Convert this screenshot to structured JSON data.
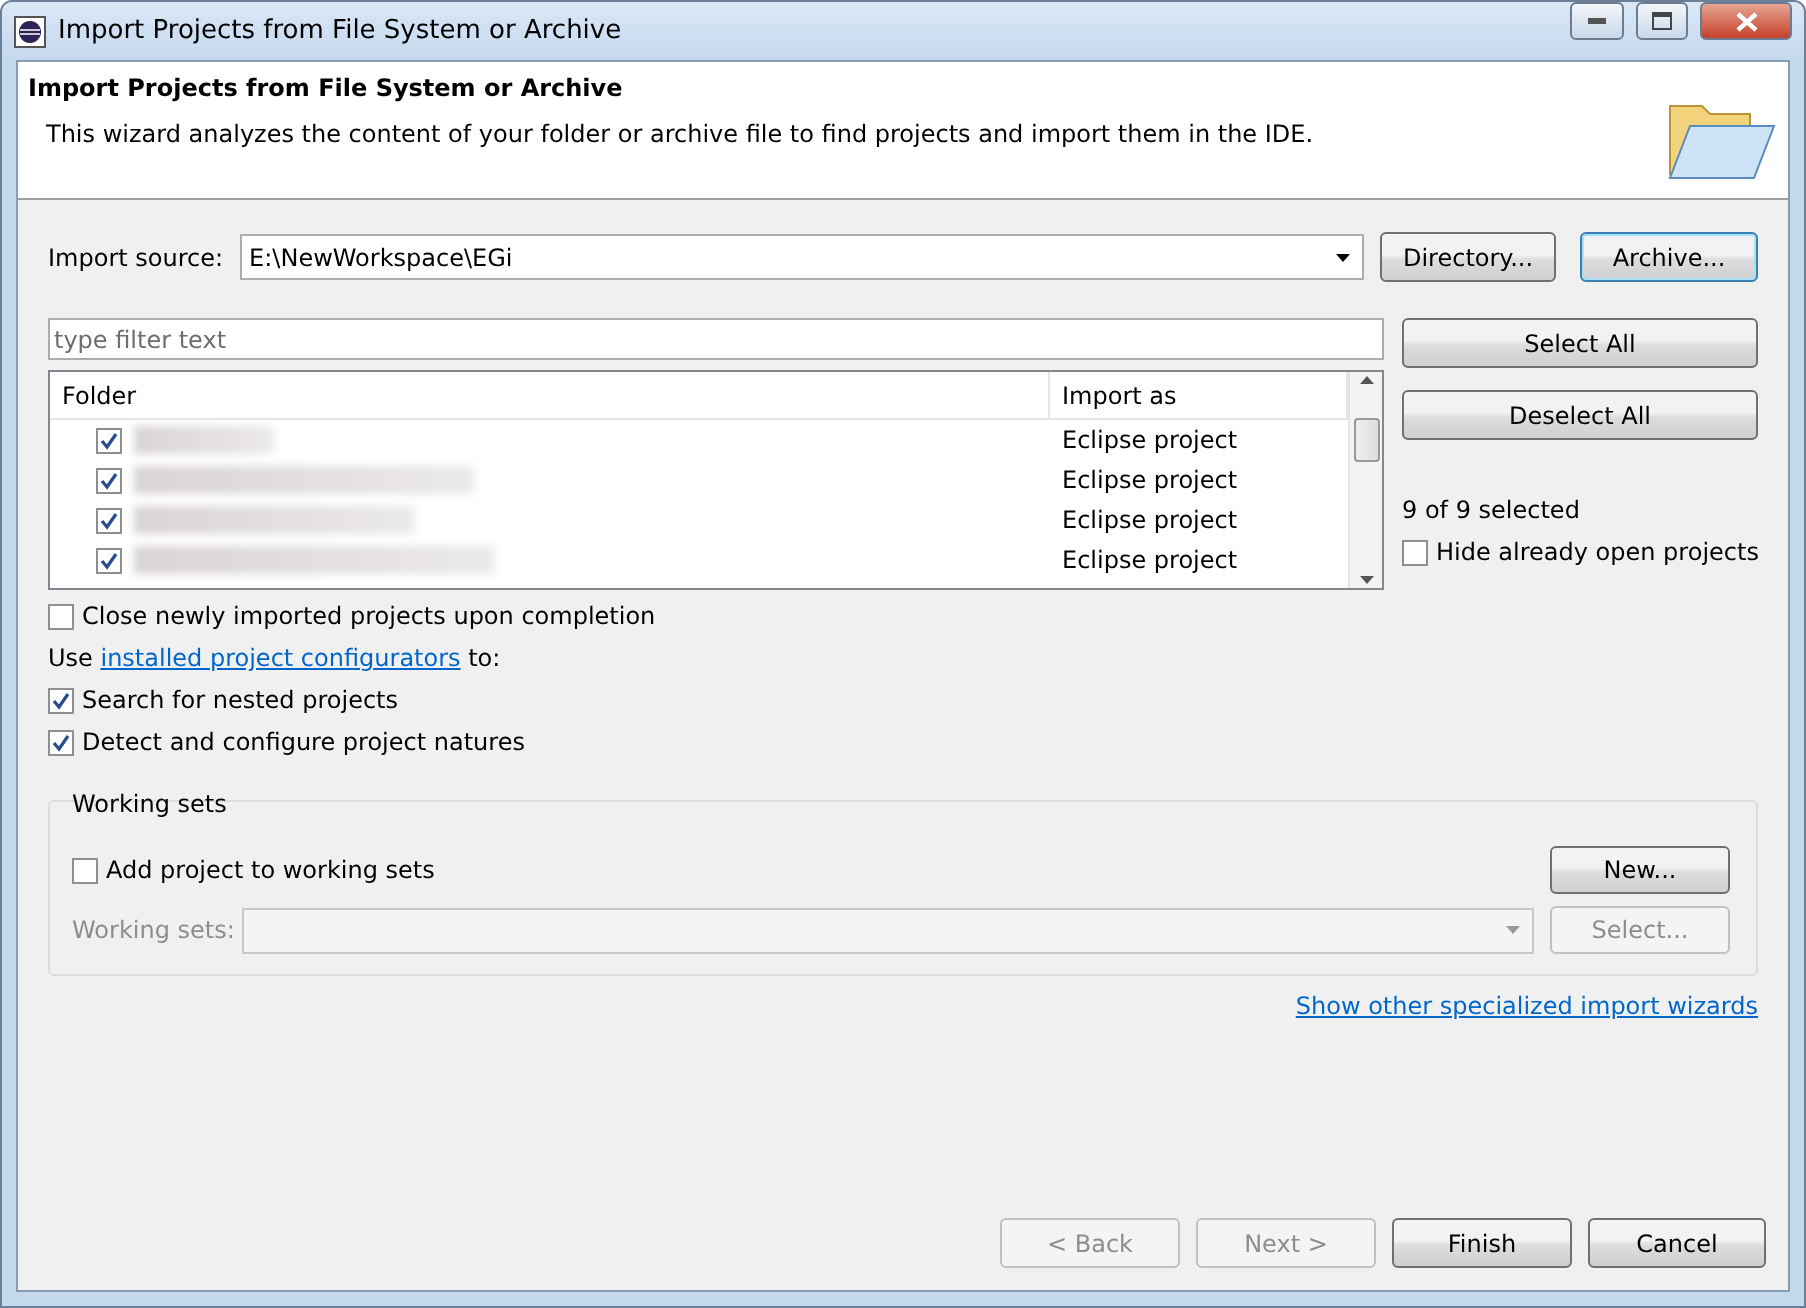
{
  "window": {
    "title": "Import Projects from File System or Archive"
  },
  "header": {
    "title": "Import Projects from File System or Archive",
    "description": "This wizard analyzes the content of your folder or archive file to find projects and import them in the IDE."
  },
  "import_source": {
    "label": "Import source:",
    "value": "E:\\NewWorkspace\\EGi",
    "buttons": [
      {
        "label": "Directory...",
        "focused": false
      },
      {
        "label": "Archive...",
        "focused": true
      }
    ]
  },
  "filter": {
    "placeholder": "type filter text"
  },
  "table": {
    "columns": [
      "Folder",
      "Import as"
    ],
    "rows": [
      {
        "checked": true,
        "import_as": "Eclipse project"
      },
      {
        "checked": true,
        "import_as": "Eclipse project"
      },
      {
        "checked": true,
        "import_as": "Eclipse project"
      },
      {
        "checked": true,
        "import_as": "Eclipse project"
      }
    ]
  },
  "side": {
    "select_all": "Select All",
    "deselect_all": "Deselect All",
    "count": "9 of 9 selected",
    "hide_open": {
      "label": "Hide already open projects",
      "checked": false
    }
  },
  "options": [
    {
      "kind": "checkbox",
      "label": "Close newly imported projects upon completion",
      "checked": false
    },
    {
      "kind": "link",
      "before": "Use ",
      "link": "installed project configurators",
      "after": " to:"
    },
    {
      "kind": "checkbox",
      "label": "Search for nested projects",
      "checked": true
    },
    {
      "kind": "checkbox",
      "label": "Detect and configure project natures",
      "checked": true
    }
  ],
  "working_sets": {
    "title": "Working sets",
    "add": {
      "label": "Add project to working sets",
      "checked": false
    },
    "new_button": "New...",
    "field_label": "Working sets:",
    "select_button": "Select...",
    "disabled": true
  },
  "more_link": "Show other specialized import wizards",
  "buttons": [
    {
      "label": "< Back",
      "disabled": true
    },
    {
      "label": "Next >",
      "disabled": true
    },
    {
      "label": "Finish",
      "disabled": false
    },
    {
      "label": "Cancel",
      "disabled": false
    }
  ]
}
